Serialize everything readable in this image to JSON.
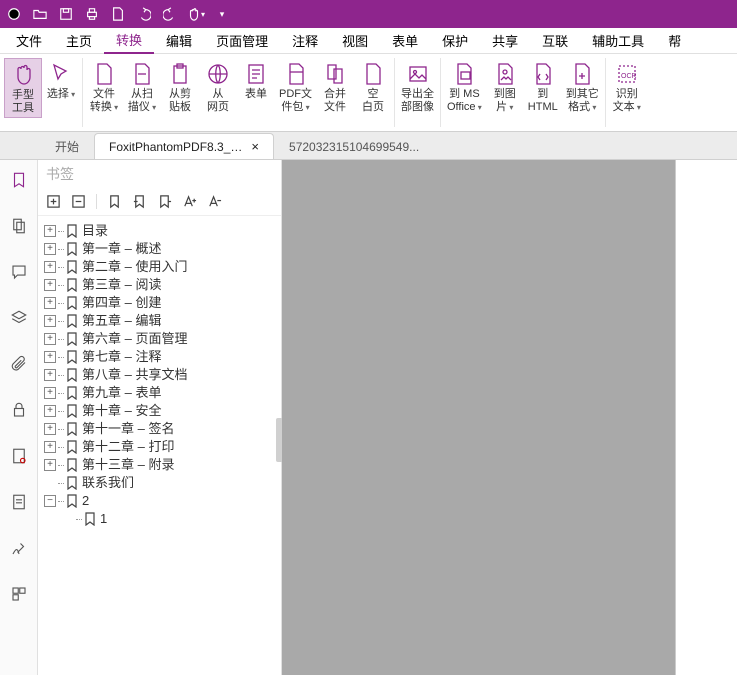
{
  "menu": [
    "文件",
    "主页",
    "转换",
    "编辑",
    "页面管理",
    "注释",
    "视图",
    "表单",
    "保护",
    "共享",
    "互联",
    "辅助工具",
    "帮"
  ],
  "menu_active_index": 2,
  "ribbon": {
    "hand": "手型\n工具",
    "select": "选择",
    "file_convert": "文件\n转换",
    "from_scanner": "从扫\n描仪",
    "from_clipboard": "从剪\n贴板",
    "from_web": "从\n网页",
    "form": "表单",
    "pdf_package": "PDF文\n件包",
    "merge": "合并\n文件",
    "blank": "空\n白页",
    "export_images": "导出全\n部图像",
    "to_office": "到 MS\nOffice",
    "to_image": "到图\n片",
    "to_html": "到\nHTML",
    "to_other": "到其它\n格式",
    "ocr": "识别\n文本"
  },
  "tabs": {
    "start": "开始",
    "active": "FoxitPhantomPDF8.3_M...",
    "inactive": "572032315104699549..."
  },
  "bookmark": {
    "title": "书签",
    "items": [
      {
        "indent": 0,
        "exp": "+",
        "label": "目录"
      },
      {
        "indent": 0,
        "exp": "+",
        "label": "第一章 – 概述"
      },
      {
        "indent": 0,
        "exp": "+",
        "label": "第二章 – 使用入门"
      },
      {
        "indent": 0,
        "exp": "+",
        "label": "第三章 – 阅读"
      },
      {
        "indent": 0,
        "exp": "+",
        "label": "第四章 – 创建"
      },
      {
        "indent": 0,
        "exp": "+",
        "label": "第五章 – 编辑"
      },
      {
        "indent": 0,
        "exp": "+",
        "label": "第六章 – 页面管理"
      },
      {
        "indent": 0,
        "exp": "+",
        "label": "第七章 – 注释"
      },
      {
        "indent": 0,
        "exp": "+",
        "label": "第八章 – 共享文档"
      },
      {
        "indent": 0,
        "exp": "+",
        "label": "第九章 – 表单"
      },
      {
        "indent": 0,
        "exp": "+",
        "label": "第十章 – 安全"
      },
      {
        "indent": 0,
        "exp": "+",
        "label": "第十一章 – 签名"
      },
      {
        "indent": 0,
        "exp": "+",
        "label": "第十二章 – 打印"
      },
      {
        "indent": 0,
        "exp": "+",
        "label": "第十三章 – 附录"
      },
      {
        "indent": 0,
        "exp": "",
        "label": "联系我们"
      },
      {
        "indent": 0,
        "exp": "-",
        "label": "2"
      },
      {
        "indent": 1,
        "exp": "",
        "label": "1"
      }
    ]
  }
}
